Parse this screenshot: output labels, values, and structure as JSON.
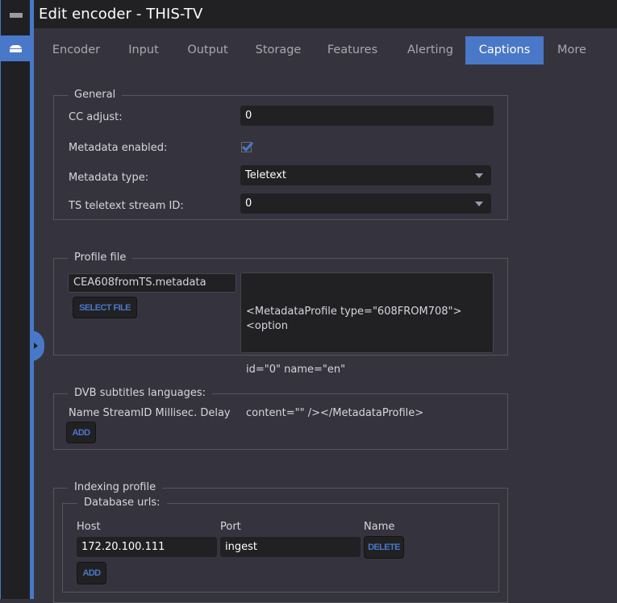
{
  "window": {
    "title": "Edit encoder - THIS-TV"
  },
  "sidebar": {
    "menu_icon": "hamburger-icon",
    "active_item_icon": "inbox-icon",
    "expand_icon": "chevron-right-icon"
  },
  "tabs": [
    {
      "label": "Encoder",
      "active": false
    },
    {
      "label": "Input",
      "active": false
    },
    {
      "label": "Output",
      "active": false
    },
    {
      "label": "Storage",
      "active": false
    },
    {
      "label": "Features",
      "active": false
    },
    {
      "label": "Alerting",
      "active": false
    },
    {
      "label": "Captions",
      "active": true
    },
    {
      "label": "More",
      "active": false
    }
  ],
  "general": {
    "legend": "General",
    "cc_adjust": {
      "label": "CC adjust:",
      "value": "0"
    },
    "metadata_enabled": {
      "label": "Metadata enabled:",
      "checked": true
    },
    "metadata_type": {
      "label": "Metadata type:",
      "value": "Teletext"
    },
    "ts_teletext_stream_id": {
      "label": "TS teletext stream ID:",
      "value": "0"
    }
  },
  "profile_file": {
    "legend": "Profile file",
    "filename": "CEA608fromTS.metadata",
    "select_file_label": "SELECT FILE",
    "content": "<MetadataProfile type=\"608FROM708\"><option id=\"0\" name=\"en\" content=\"\" /></MetadataProfile>",
    "content_lines": [
      "<MetadataProfile type=\"608FROM708\"><option",
      "id=\"0\" name=\"en\"",
      "content=\"\" /></MetadataProfile>"
    ]
  },
  "dvb_subtitles": {
    "legend": "DVB subtitles languages:",
    "columns_text": "Name StreamID Millisec. Delay",
    "add_label": "ADD"
  },
  "indexing_profile": {
    "legend": "Indexing profile",
    "database_urls": {
      "legend": "Database urls:",
      "columns": {
        "host": "Host",
        "port": "Port",
        "name": "Name"
      },
      "rows": [
        {
          "host": "172.20.100.111",
          "port": "ingest",
          "delete_label": "DELETE"
        }
      ],
      "add_label": "ADD"
    }
  }
}
